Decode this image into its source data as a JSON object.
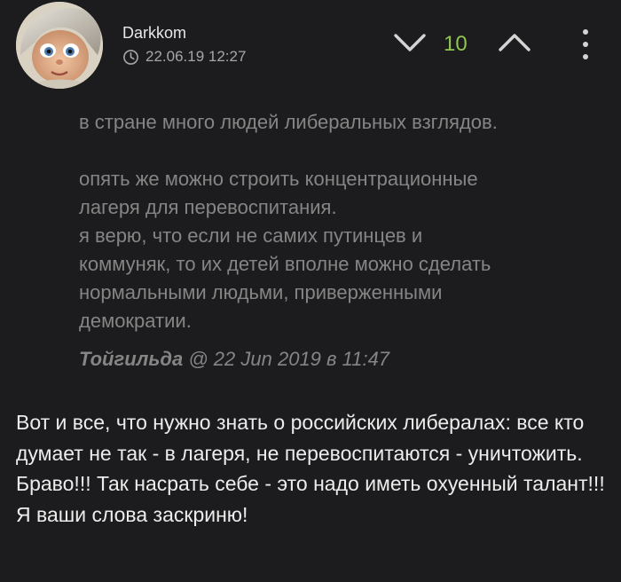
{
  "comment": {
    "author": "Darkkom",
    "timestamp": "22.06.19 12:27",
    "rating": "10",
    "quote": {
      "text": "в стране много людей либеральных взглядов.\n\nопять же можно строить концентрационные\nлагеря для перевоспитания.\nя верю, что если не самих путинцев и\nкоммуняк, то их детей вполне можно сделать\nнормальными людьми, приверженными\nдемократии.",
      "author": "Тойгильда",
      "meta": " @ 22 Jun 2019 в 11:47"
    },
    "body": "Вот и все, что нужно знать о российских либералах: все кто думает не так - в лагеря, не перевоспитаются - уничтожить. Браво!!! Так насрать себе - это надо иметь охуенный талант!!! Я ваши слова заскриню!"
  },
  "colors": {
    "background": "#1c1c1e",
    "rating": "#8fc450",
    "quote_text": "#858585",
    "body_text": "#ececec"
  },
  "icons": {
    "clock": "clock-icon",
    "vote_down": "chevron-down-icon",
    "vote_up": "chevron-up-icon",
    "menu": "kebab-menu-icon"
  }
}
